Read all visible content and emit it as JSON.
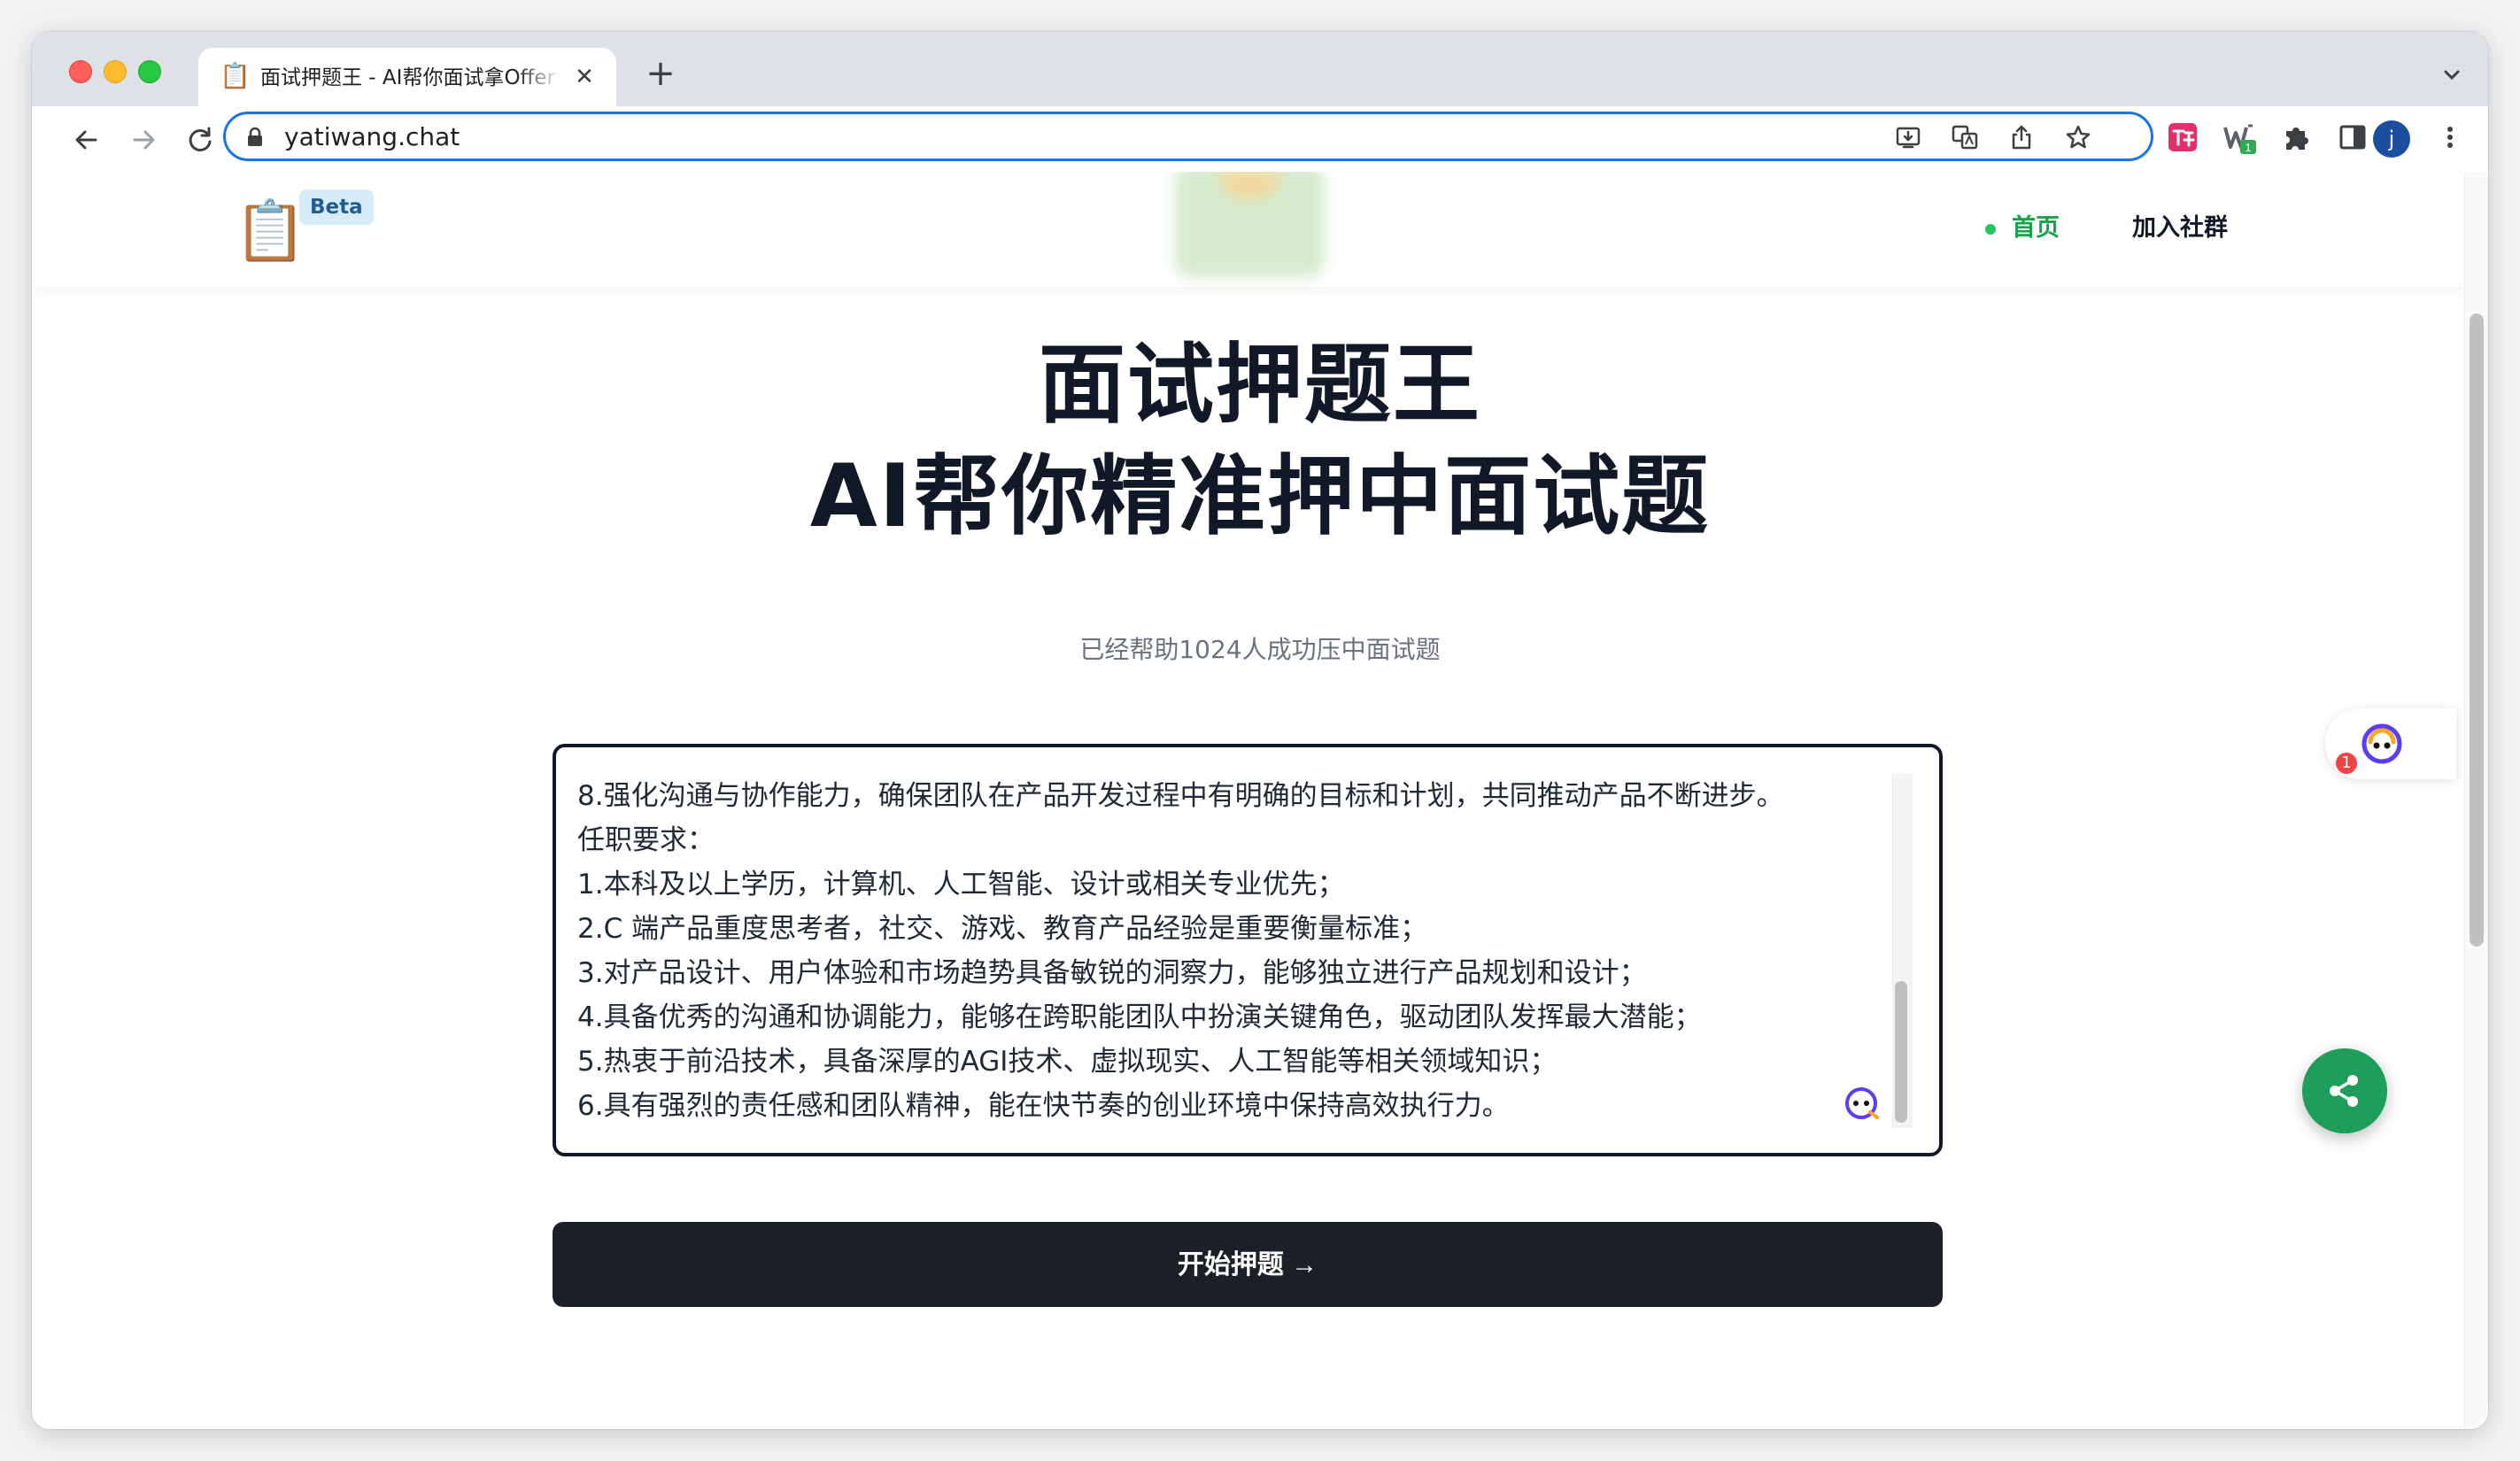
{
  "browser": {
    "tab_title": "面试押题王 - AI帮你面试拿Offer",
    "tab_favicon": "📋",
    "tab_close": "✕",
    "new_tab": "+",
    "url": "yatiwang.chat",
    "avatar_letter": "j",
    "extension_badge": "1"
  },
  "site": {
    "logo_icon": "📋",
    "beta_label": "Beta",
    "nav_home": "首页",
    "nav_join": "加入社群"
  },
  "hero": {
    "title_line1": "面试押题王",
    "title_line2": "AI帮你精准押中面试题",
    "subtitle": "已经帮助1024人成功压中面试题"
  },
  "jd": {
    "lines": [
      "8.强化沟通与协作能力，确保团队在产品开发过程中有明确的目标和计划，共同推动产品不断进步。",
      "任职要求：",
      "1.本科及以上学历，计算机、人工智能、设计或相关专业优先；",
      "2.C 端产品重度思考者，社交、游戏、教育产品经验是重要衡量标准；",
      "3.对产品设计、用户体验和市场趋势具备敏锐的洞察力，能够独立进行产品规划和设计；",
      "4.具备优秀的沟通和协调能力，能够在跨职能团队中扮演关键角色，驱动团队发挥最大潜能；",
      "5.热衷于前沿技术，具备深厚的AGI技术、虚拟现实、人工智能等相关领域知识；",
      "6.具有强烈的责任感和团队精神，能在快节奏的创业环境中保持高效执行力。"
    ]
  },
  "actions": {
    "start_button": "开始押题 →"
  },
  "floating": {
    "assistant_badge": "1"
  },
  "colors": {
    "accent_green": "#16a34a",
    "button_dark": "#1b1f27",
    "share_green": "#1e9e5a",
    "omnibox_blue": "#1a73e8"
  }
}
